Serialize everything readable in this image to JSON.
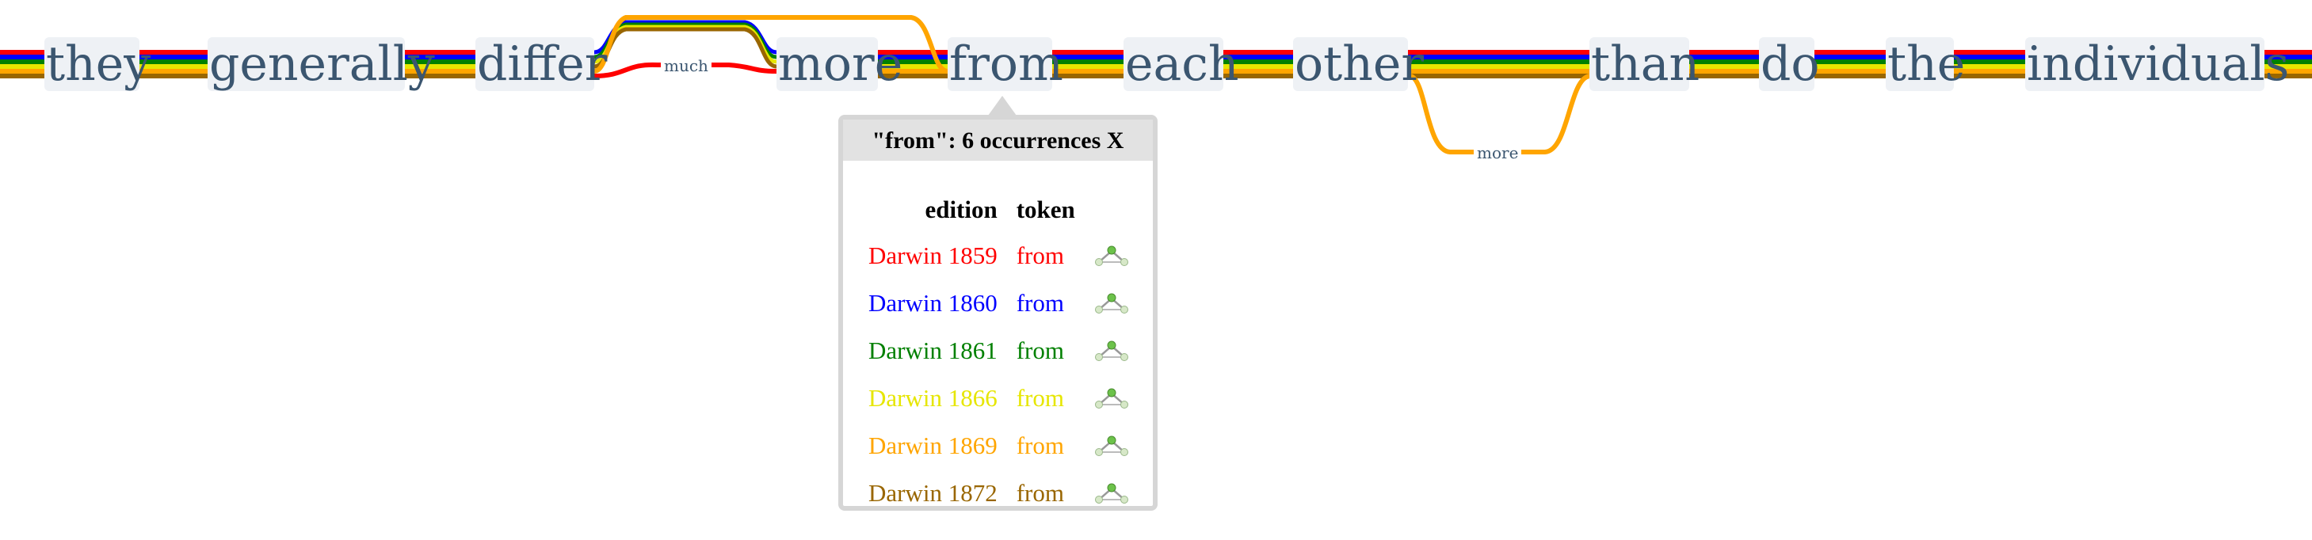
{
  "tokens": [
    "they",
    "generally",
    "differ",
    "more",
    "from",
    "each",
    "other",
    "than",
    "do",
    "the",
    "individuals"
  ],
  "edge_labels": {
    "much": "much",
    "more": "more"
  },
  "edition_colors": [
    "#ff0000",
    "#0000ff",
    "#008000",
    "#e6e600",
    "#ffa500",
    "#996600"
  ],
  "popup": {
    "title": "\"from\": 6 occurrences",
    "close": "X",
    "columns": {
      "edition": "edition",
      "token": "token"
    },
    "rows": [
      {
        "edition": "Darwin 1859",
        "token": "from",
        "color": "#ff0000",
        "icon": "tree-icon"
      },
      {
        "edition": "Darwin 1860",
        "token": "from",
        "color": "#0000ff",
        "icon": "tree-icon"
      },
      {
        "edition": "Darwin 1861",
        "token": "from",
        "color": "#008000",
        "icon": "tree-icon"
      },
      {
        "edition": "Darwin 1866",
        "token": "from",
        "color": "#e6e600",
        "icon": "tree-icon"
      },
      {
        "edition": "Darwin 1869",
        "token": "from",
        "color": "#ffa500",
        "icon": "tree-icon"
      },
      {
        "edition": "Darwin 1872",
        "token": "from",
        "color": "#996600",
        "icon": "tree-icon"
      }
    ]
  }
}
